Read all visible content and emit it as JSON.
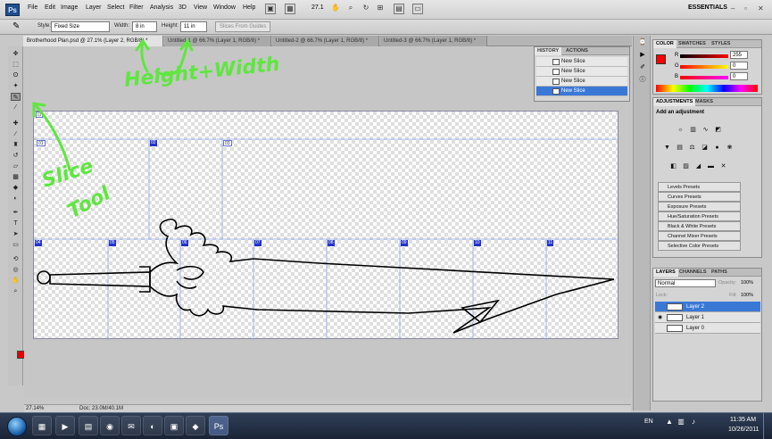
{
  "menubar": {
    "logo": "Ps",
    "items": [
      "File",
      "Edit",
      "Image",
      "Layer",
      "Select",
      "Filter",
      "Analysis",
      "3D",
      "View",
      "Window",
      "Help"
    ],
    "zoom": "27.1",
    "workspace": "ESSENTIALS"
  },
  "options": {
    "style_label": "Style:",
    "style_value": "Fixed Size",
    "width_label": "Width:",
    "width_value": "8 in",
    "height_label": "Height:",
    "height_value": "11 in",
    "guides_button": "Slices From Guides"
  },
  "tabs": [
    {
      "label": "Brotherhood Plan.psd @ 27.1% (Layer 2, RGB/8) *",
      "active": true
    },
    {
      "label": "Untitled-1 @ 66.7% (Layer 1, RGB/8) *",
      "active": false
    },
    {
      "label": "Untitled-2 @ 66.7% (Layer 1, RGB/8) *",
      "active": false
    },
    {
      "label": "Untitled-3 @ 66.7% (Layer 1, RGB/8) *",
      "active": false
    }
  ],
  "history": {
    "tab_history": "HISTORY",
    "tab_actions": "ACTIONS",
    "rows": [
      "New Slice",
      "New Slice",
      "New Slice",
      "New Slice"
    ]
  },
  "color_panel": {
    "tabs": [
      "COLOR",
      "SWATCHES",
      "STYLES"
    ],
    "r_label": "R",
    "r_value": "255",
    "g_label": "G",
    "g_value": "0",
    "b_label": "B",
    "b_value": "0"
  },
  "adjustments": {
    "tabs": [
      "ADJUSTMENTS",
      "MASKS"
    ],
    "heading": "Add an adjustment",
    "presets": [
      "Levels Presets",
      "Curves Presets",
      "Exposure Presets",
      "Hue/Saturation Presets",
      "Black & White Presets",
      "Channel Mixer Presets",
      "Selective Color Presets"
    ]
  },
  "layers": {
    "tabs": [
      "LAYERS",
      "CHANNELS",
      "PATHS"
    ],
    "blend_mode": "Normal",
    "opacity_label": "Opacity:",
    "opacity_value": "100%",
    "lock_label": "Lock:",
    "fill_label": "Fill:",
    "fill_value": "100%",
    "rows": [
      {
        "name": "Layer 2",
        "selected": true
      },
      {
        "name": "Layer 1",
        "selected": false
      },
      {
        "name": "Layer 0",
        "selected": false
      }
    ]
  },
  "status": {
    "zoom": "27.14%",
    "doc": "Doc: 23.0M/40.1M"
  },
  "slices": {
    "row1": [
      "01",
      "02",
      "03"
    ],
    "row2": [
      "04",
      "05",
      "06",
      "07",
      "08",
      "09",
      "10",
      "11",
      "12",
      "13"
    ]
  },
  "annotations": {
    "width_note": "Height+Width",
    "slice_note_1": "Slice",
    "slice_note_2": "Tool"
  },
  "taskbar": {
    "lang": "EN",
    "time": "11:35 AM",
    "date": "10/26/2011"
  },
  "colors": {
    "foreground": "#ff0000",
    "annotation": "#5fe640",
    "selection": "#3a78d6"
  }
}
